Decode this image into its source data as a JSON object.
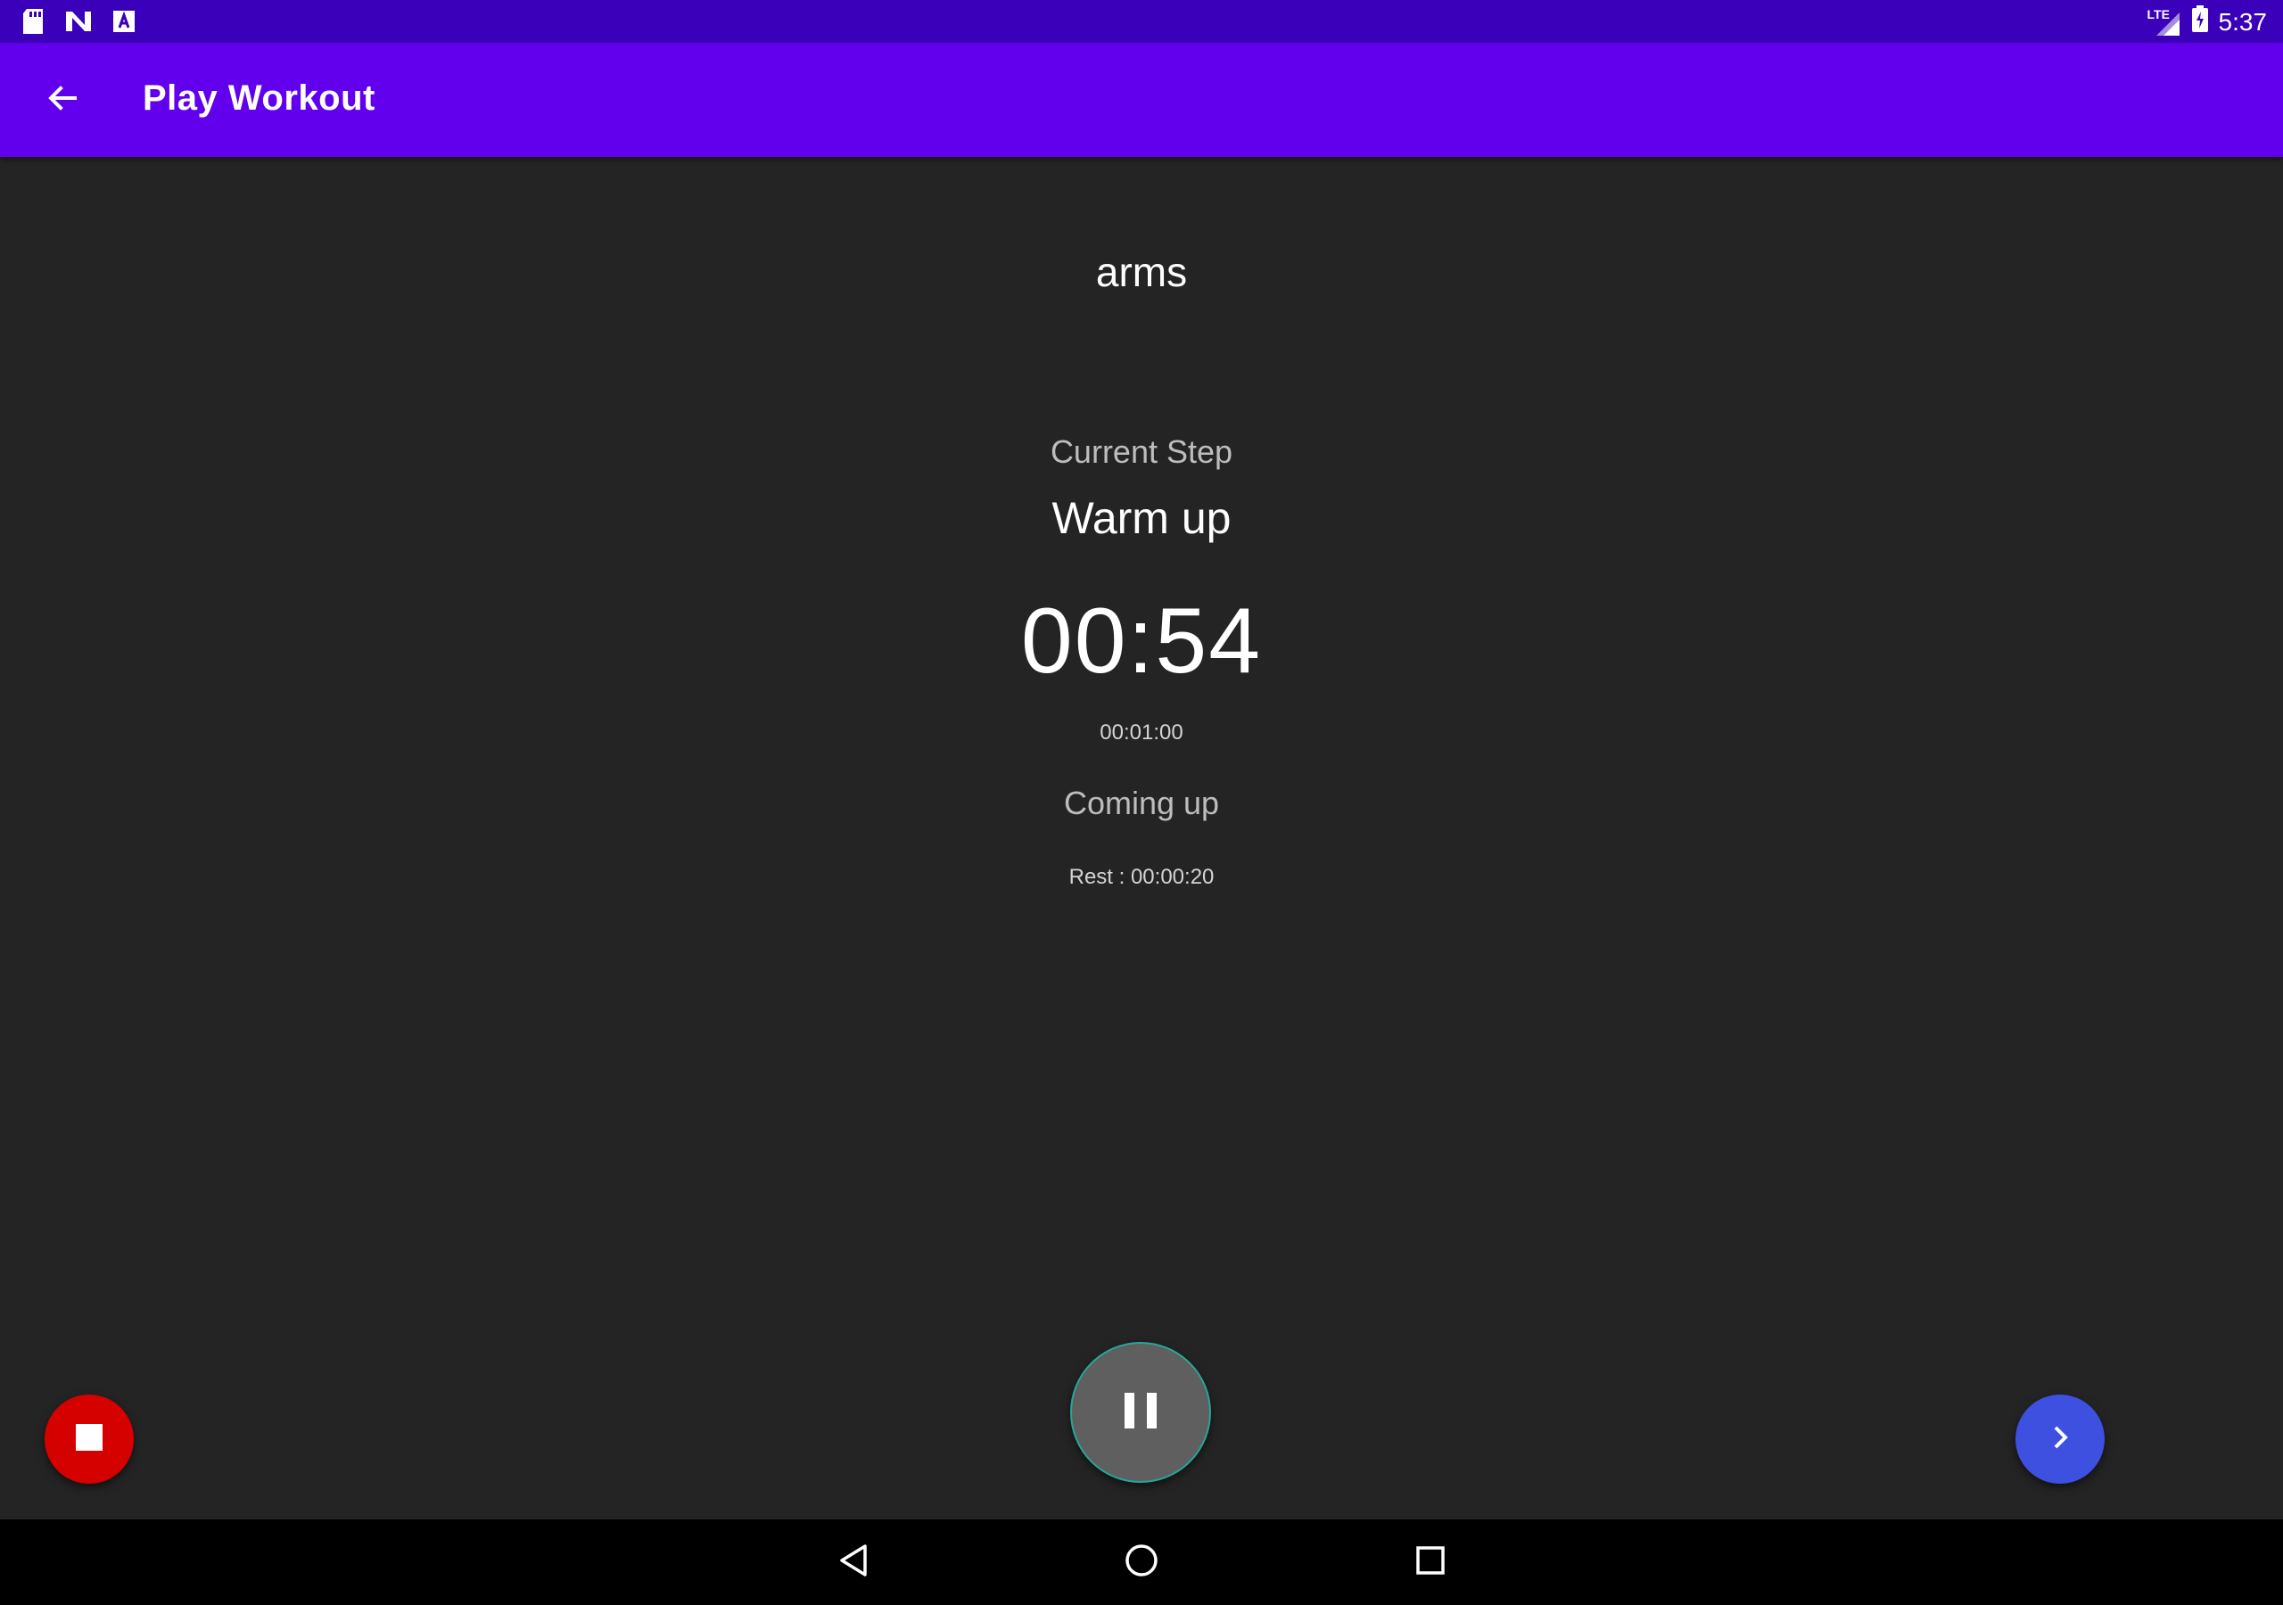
{
  "status_bar": {
    "left_icons": [
      "sd-card-icon",
      "n-notification-icon",
      "a-notification-icon"
    ],
    "network": "LTE",
    "time": "5:37"
  },
  "app_bar": {
    "title": "Play Workout",
    "back_icon": "arrow-back-icon",
    "color": "#6200ee"
  },
  "workout": {
    "name": "arms",
    "current_step_label": "Current Step",
    "current_step": "Warm up",
    "remaining_time": "00:54",
    "step_duration": "00:01:00",
    "coming_up_label": "Coming up",
    "next_step": "Rest : 00:00:20"
  },
  "controls": {
    "stop_icon": "stop-icon",
    "stop_color": "#d50000",
    "pause_icon": "pause-icon",
    "pause_color": "#5f5f5f",
    "next_icon": "chevron-right-icon",
    "next_color": "#3d50e0"
  },
  "nav_bar": {
    "buttons": [
      "back-triangle-icon",
      "home-circle-icon",
      "recents-square-icon"
    ]
  }
}
